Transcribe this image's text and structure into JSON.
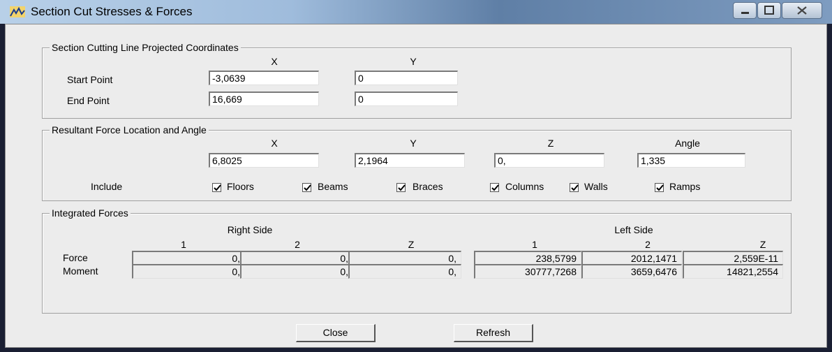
{
  "window": {
    "title": "Section Cut Stresses & Forces"
  },
  "coords": {
    "group_title": "Section Cutting Line Projected Coordinates",
    "col_x": "X",
    "col_y": "Y",
    "start_label": "Start Point",
    "start_x": "-3,0639",
    "start_y": "0",
    "end_label": "End Point",
    "end_x": "16,669",
    "end_y": "0"
  },
  "resultant": {
    "group_title": "Resultant Force Location and Angle",
    "col_x": "X",
    "col_y": "Y",
    "col_z": "Z",
    "col_angle": "Angle",
    "x": "6,8025",
    "y": "2,1964",
    "z": "0,",
    "angle": "1,335",
    "include_label": "Include",
    "options": [
      {
        "label": "Floors",
        "checked": true
      },
      {
        "label": "Beams",
        "checked": true
      },
      {
        "label": "Braces",
        "checked": true
      },
      {
        "label": "Columns",
        "checked": true
      },
      {
        "label": "Walls",
        "checked": true
      },
      {
        "label": "Ramps",
        "checked": true
      }
    ]
  },
  "integrated": {
    "group_title": "Integrated Forces",
    "right_side": "Right Side",
    "left_side": "Left Side",
    "cols": [
      "1",
      "2",
      "Z",
      "1",
      "2",
      "Z"
    ],
    "rows": [
      {
        "label": "Force",
        "values": [
          "0,",
          "0,",
          "0,",
          "238,5799",
          "2012,1471",
          "2,559E-11"
        ]
      },
      {
        "label": "Moment",
        "values": [
          "0,",
          "0,",
          "0,",
          "30777,7268",
          "3659,6476",
          "14821,2554"
        ]
      }
    ]
  },
  "buttons": {
    "close": "Close",
    "refresh": "Refresh"
  }
}
